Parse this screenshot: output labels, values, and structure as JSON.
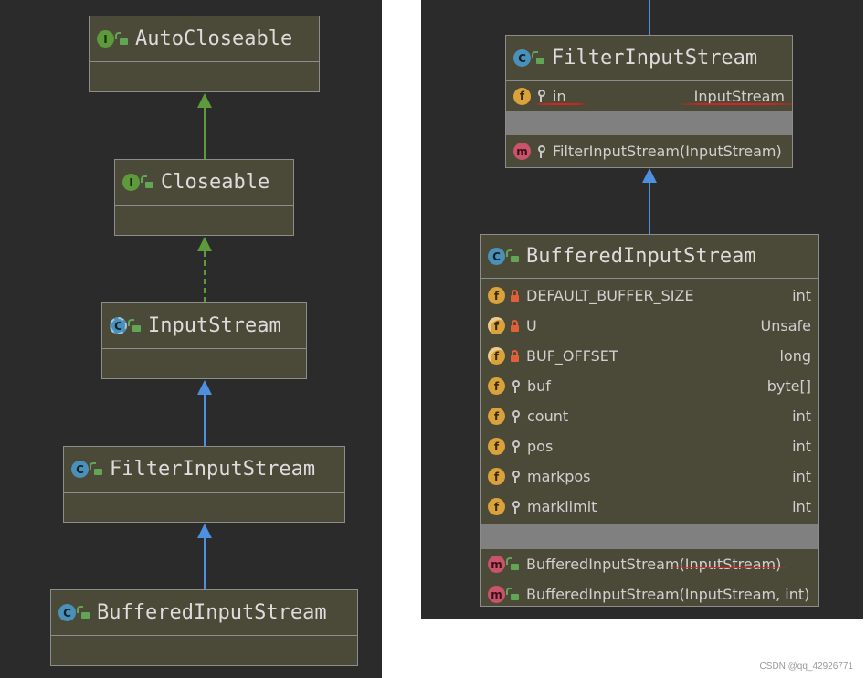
{
  "colors": {
    "background": "#2b2b2b",
    "node_fill": "#4b4938",
    "node_border": "#8c8c8c",
    "implements_arrow": "#5c9a3c",
    "extends_arrow": "#4f8fe0",
    "underline": "#e02020"
  },
  "left_diagram": {
    "nodes": [
      {
        "label": "AutoCloseable",
        "kind": "interface",
        "badge": "I"
      },
      {
        "label": "Closeable",
        "kind": "interface",
        "badge": "I"
      },
      {
        "label": "InputStream",
        "kind": "abstract-class",
        "badge": "C"
      },
      {
        "label": "FilterInputStream",
        "kind": "class",
        "badge": "C"
      },
      {
        "label": "BufferedInputStream",
        "kind": "class",
        "badge": "C"
      }
    ]
  },
  "right_diagram": {
    "filter_class": {
      "title": "FilterInputStream",
      "badge": "C",
      "fields": [
        {
          "badge": "f",
          "name": "in",
          "type": "InputStream"
        }
      ],
      "methods": [
        {
          "badge": "m",
          "name": "FilterInputStream(InputStream)"
        }
      ]
    },
    "buffered_class": {
      "title": "BufferedInputStream",
      "badge": "C",
      "fields": [
        {
          "badge": "f",
          "name": "DEFAULT_BUFFER_SIZE",
          "type": "int"
        },
        {
          "badge": "f",
          "name": "U",
          "type": "Unsafe"
        },
        {
          "badge": "f",
          "name": "BUF_OFFSET",
          "type": "long"
        },
        {
          "badge": "f",
          "name": "buf",
          "type": "byte[]"
        },
        {
          "badge": "f",
          "name": "count",
          "type": "int"
        },
        {
          "badge": "f",
          "name": "pos",
          "type": "int"
        },
        {
          "badge": "f",
          "name": "markpos",
          "type": "int"
        },
        {
          "badge": "f",
          "name": "marklimit",
          "type": "int"
        }
      ],
      "methods": [
        {
          "badge": "m",
          "name": "BufferedInputStream(InputStream)"
        },
        {
          "badge": "m",
          "name": "BufferedInputStream(InputStream, int)"
        }
      ]
    }
  },
  "watermark": "CSDN @qq_42926771"
}
